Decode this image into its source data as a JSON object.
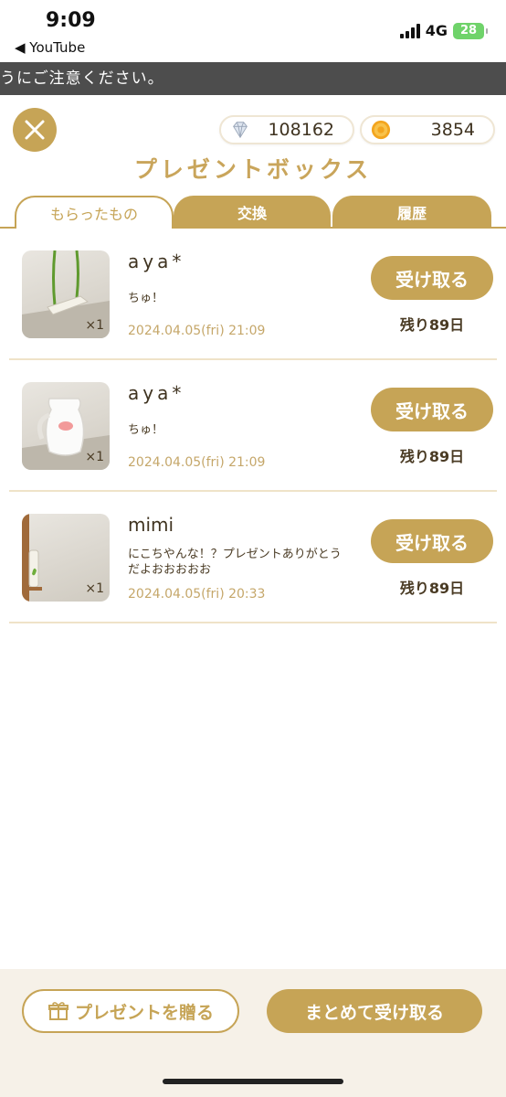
{
  "status_bar": {
    "time": "9:09",
    "back_app": "◀ YouTube",
    "network": "4G",
    "battery": "28"
  },
  "notice": {
    "text": "うにご注意ください。"
  },
  "header": {
    "diamonds": "108162",
    "coins": "3854",
    "title": "プレゼントボックス"
  },
  "tabs": [
    {
      "label": "もらったもの",
      "active": true
    },
    {
      "label": "交換",
      "active": false
    },
    {
      "label": "履歴",
      "active": false
    }
  ],
  "items": [
    {
      "sender": "aya*",
      "message": "ちゅ！",
      "date": "2024.04.05(fri) 21:09",
      "qty": "×1",
      "receive_label": "受け取る",
      "remaining": "残り89日",
      "thumb_icon": "swing-icon"
    },
    {
      "sender": "aya*",
      "message": "ちゅ！",
      "date": "2024.04.05(fri) 21:09",
      "qty": "×1",
      "receive_label": "受け取る",
      "remaining": "残り89日",
      "thumb_icon": "pitcher-icon"
    },
    {
      "sender": "mimi",
      "message": "にこちやんな！？プレゼントありがとうだよおおおおお",
      "date": "2024.04.05(fri) 20:33",
      "qty": "×1",
      "receive_label": "受け取る",
      "remaining": "残り89日",
      "thumb_icon": "wall-shelf-icon"
    }
  ],
  "footer": {
    "gift_label": "プレゼントを贈る",
    "bulk_receive_label": "まとめて受け取る"
  },
  "colors": {
    "accent": "#c6a456",
    "title": "#c9a55b",
    "date": "#c5a76a",
    "footer_bg": "#f6f1e8"
  }
}
